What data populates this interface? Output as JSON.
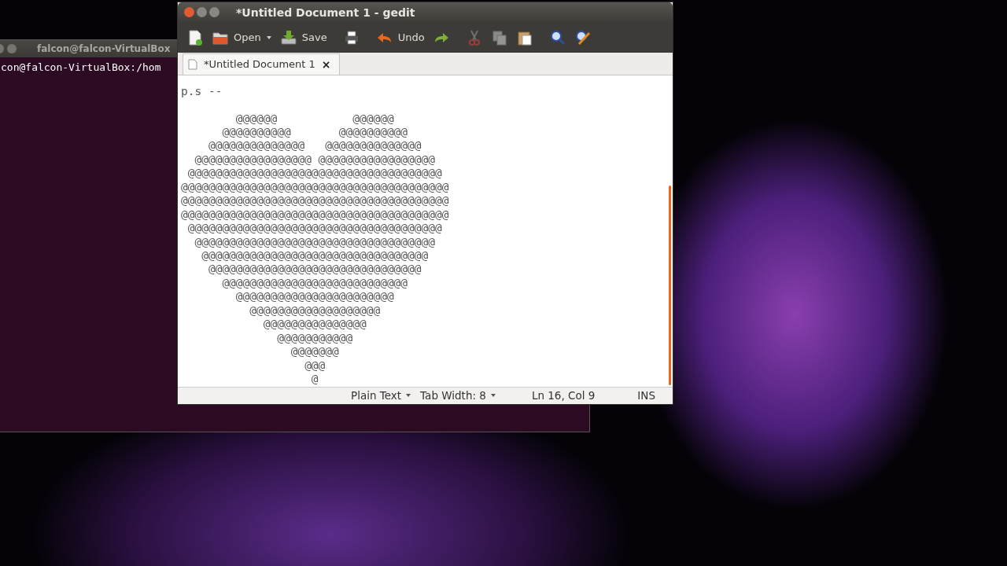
{
  "terminal": {
    "title": "falcon@falcon-VirtualBox",
    "prompt": "con@falcon-VirtualBox:/hom"
  },
  "window": {
    "title": "*Untitled Document 1 - gedit"
  },
  "toolbar": [
    {
      "kind": "new",
      "disabled": false
    },
    {
      "kind": "open",
      "label": "Open",
      "disabled": false,
      "dropdown": true
    },
    {
      "kind": "save",
      "label": "Save",
      "disabled": false
    },
    {
      "kind": "print",
      "disabled": false
    },
    {
      "kind": "undo",
      "label": "Undo",
      "disabled": false
    },
    {
      "kind": "redo",
      "disabled": false
    },
    {
      "kind": "cut",
      "disabled": true
    },
    {
      "kind": "copy",
      "disabled": true
    },
    {
      "kind": "paste",
      "disabled": false
    },
    {
      "kind": "find",
      "disabled": false
    },
    {
      "kind": "replace",
      "disabled": false
    }
  ],
  "tabs": [
    {
      "label": "*Untitled Document 1",
      "close": "×",
      "selected": true
    }
  ],
  "editor": {
    "first_line": "p.s --",
    "art_lines": [
      "        @@@@@@           @@@@@@",
      "      @@@@@@@@@@       @@@@@@@@@@",
      "    @@@@@@@@@@@@@@   @@@@@@@@@@@@@@",
      "  @@@@@@@@@@@@@@@@@ @@@@@@@@@@@@@@@@@",
      " @@@@@@@@@@@@@@@@@@@@@@@@@@@@@@@@@@@@@",
      "@@@@@@@@@@@@@@@@@@@@@@@@@@@@@@@@@@@@@@@",
      "@@@@@@@@@@@@@@@@@@@@@@@@@@@@@@@@@@@@@@@",
      "@@@@@@@@@@@@@@@@@@@@@@@@@@@@@@@@@@@@@@@",
      " @@@@@@@@@@@@@@@@@@@@@@@@@@@@@@@@@@@@@",
      "  @@@@@@@@@@@@@@@@@@@@@@@@@@@@@@@@@@@",
      "   @@@@@@@@@@@@@@@@@@@@@@@@@@@@@@@@@",
      "    @@@@@@@@@@@@@@@@@@@@@@@@@@@@@@@",
      "      @@@@@@@@@@@@@@@@@@@@@@@@@@@",
      "        @@@@@@@@@@@@@@@@@@@@@@@",
      "          @@@@@@@@@@@@@@@@@@@",
      "            @@@@@@@@@@@@@@@",
      "              @@@@@@@@@@@",
      "                @@@@@@@",
      "                  @@@",
      "                   @"
    ]
  },
  "status_bar": [
    {
      "text": "Plain Text",
      "dropdown": true
    },
    {
      "text": "Tab Width:  8",
      "dropdown": true
    },
    {
      "text": "Ln 16, Col 9",
      "dropdown": false
    },
    {
      "text": "INS",
      "dropdown": false
    }
  ]
}
